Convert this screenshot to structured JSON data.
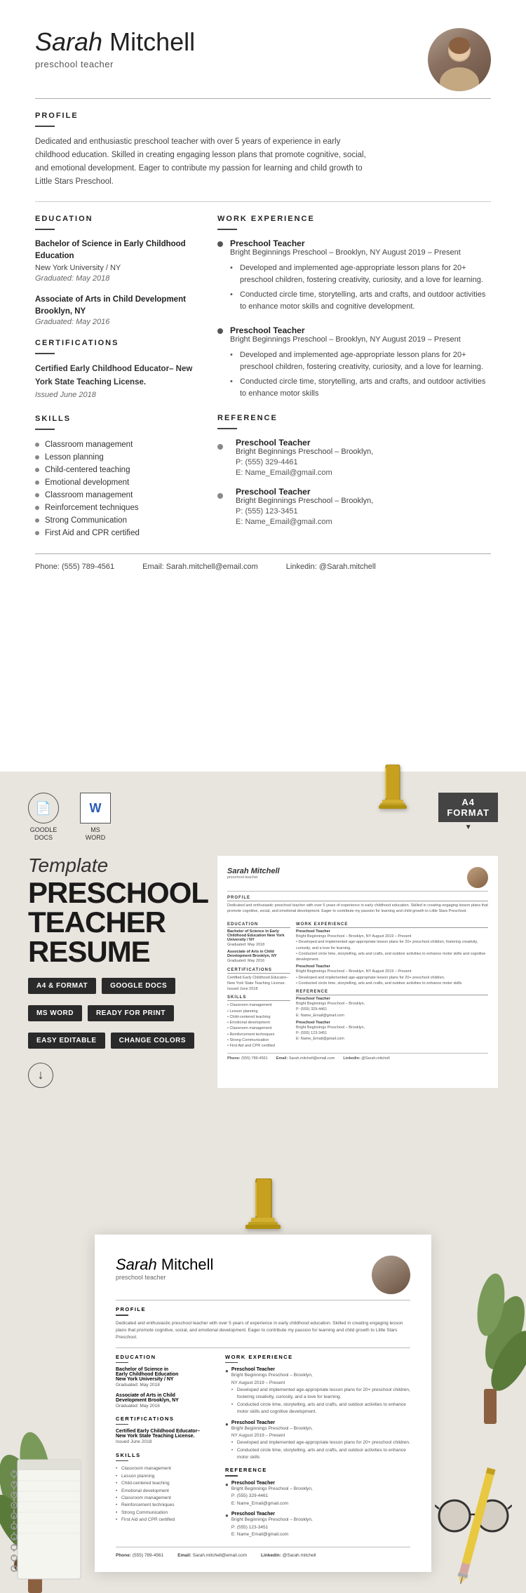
{
  "resume": {
    "name_italic": "Sarah",
    "name_bold": " Mitchell",
    "title": "preschool teacher",
    "profile": {
      "section_title": "PROFILE",
      "text": "Dedicated and enthusiastic preschool teacher with over 5 years of experience in early childhood education. Skilled in creating engaging lesson plans that promote cognitive, social, and emotional development. Eager to contribute my passion for learning and child growth to Little Stars Preschool."
    },
    "education": {
      "section_title": "EDUCATION",
      "entries": [
        {
          "degree": "Bachelor of Science in Early Childhood Education",
          "school": "New York University / NY",
          "date": "Graduated: May 2018"
        },
        {
          "degree": "Associate of Arts in Child Development Brooklyn, NY",
          "school": "",
          "date": "Graduated: May 2016"
        }
      ]
    },
    "certifications": {
      "section_title": "CERTIFICATIONS",
      "text": "Certified Early Childhood Educator– New York State Teaching License.",
      "date": "Issued June 2018"
    },
    "skills": {
      "section_title": "SKILLS",
      "items": [
        "Classroom management",
        "Lesson planning",
        "Child-centered teaching",
        "Emotional development",
        "Classroom management",
        "Reinforcement techniques",
        "Strong Communication",
        "First Aid and CPR certified"
      ]
    },
    "work_experience": {
      "section_title": "WORK EXPERIENCE",
      "entries": [
        {
          "title": "Preschool Teacher",
          "company": "Bright Beginnings Preschool – Brooklyn, NY August 2019 – Present",
          "bullets": [
            "Developed and implemented age-appropriate lesson plans for 20+ preschool children, fostering creativity, curiosity, and a love for learning.",
            "Conducted circle time, storytelling, arts and crafts, and outdoor activities to enhance motor skills and cognitive development."
          ]
        },
        {
          "title": "Preschool Teacher",
          "company": "Bright Beginnings Preschool – Brooklyn, NY August 2019 – Present",
          "bullets": [
            "Developed and implemented age-appropriate lesson plans for 20+ preschool children, fostering creativity, curiosity, and a love for learning.",
            "Conducted circle time, storytelling, arts and crafts, and outdoor activities to enhance motor skills"
          ]
        }
      ]
    },
    "reference": {
      "section_title": "REFERENCE",
      "entries": [
        {
          "title": "Preschool Teacher",
          "company": "Bright Beginnings Preschool – Brooklyn,",
          "phone": "P: (555) 329-4461",
          "email": "E: Name_Email@gmail.com"
        },
        {
          "title": "Preschool Teacher",
          "company": "Bright Beginnings Preschool – Brooklyn,",
          "phone": "P: (555) 123-3451",
          "email": "E: Name_Email@gmail.com"
        }
      ]
    },
    "footer": {
      "phone_label": "Phone:",
      "phone": "(555) 789-4561",
      "email_label": "Email:",
      "email": "Sarah.mitchell@email.com",
      "linkedin_label": "Linkedin:",
      "linkedin": "@Sarah.mitchell"
    }
  },
  "marketing": {
    "google_docs_label": "GOODLE\nDOCS",
    "ms_word_label": "MS\nWORD",
    "a4_label": "A4\nFORMAT",
    "template_label": "Template",
    "title_line1": "PRESCHOOL",
    "title_line2": "TEACHER",
    "title_line3": "RESUME",
    "badges": [
      "A4 & FORMAT",
      "GOOGLE DOCS",
      "MS WORD",
      "READY FOR PRINT",
      "EASY EDITABLE",
      "CHANGE COLORS"
    ]
  }
}
